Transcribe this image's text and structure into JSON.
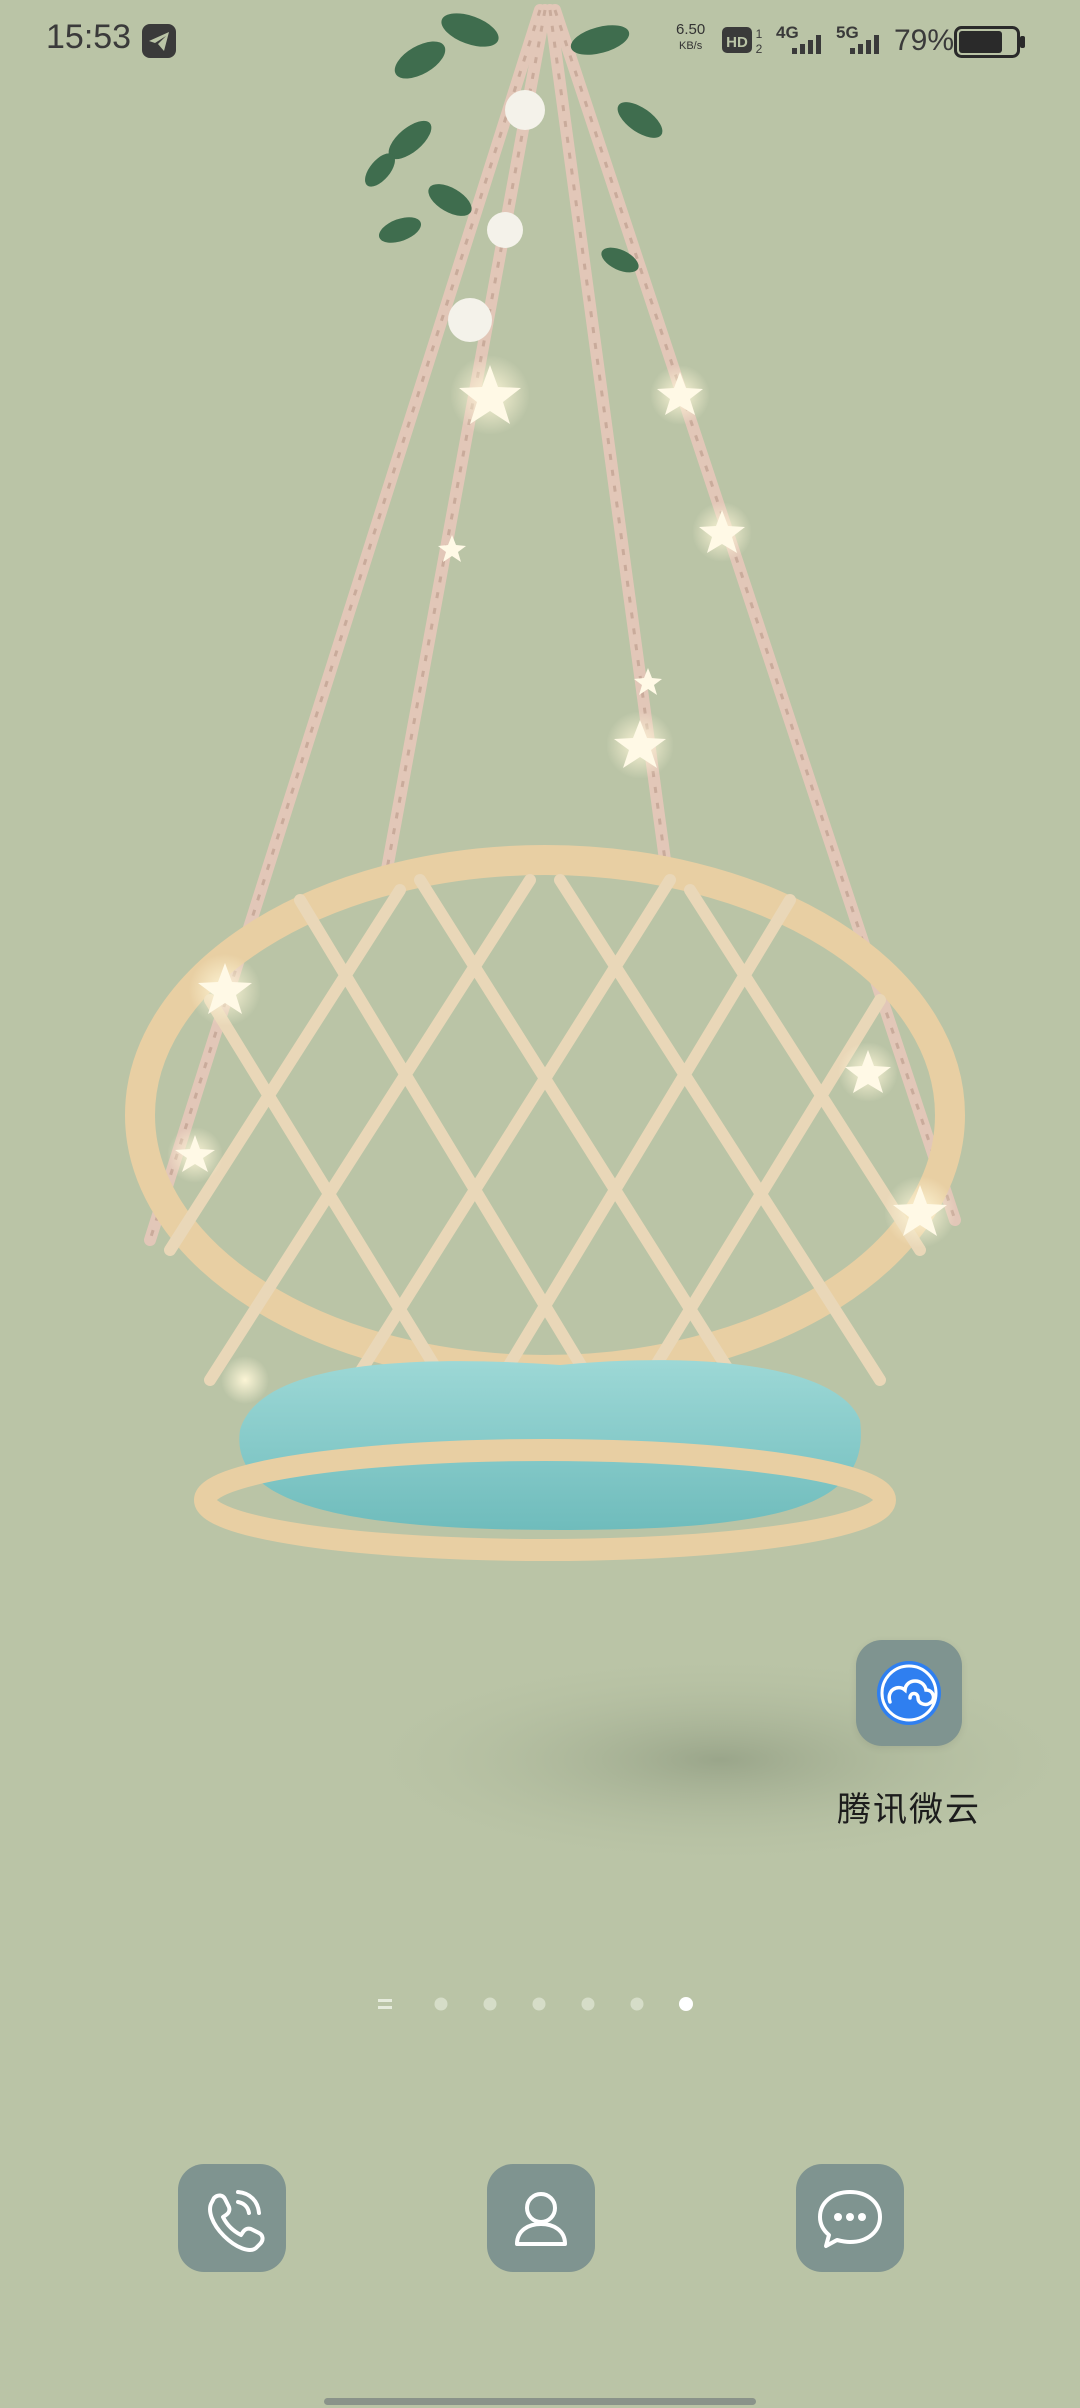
{
  "status_bar": {
    "time": "15:53",
    "net_speed_value": "6.50",
    "net_speed_unit": "KB/s",
    "hd_label": "HD",
    "sim_label_a": "4G",
    "sim_label_b": "5G",
    "battery_percent": "79%",
    "battery_level": 0.79
  },
  "home": {
    "apps": [
      {
        "label": "腾讯微云",
        "icon": "tencent-weiyun-cloud-icon"
      }
    ],
    "page_indicator": {
      "pages": 6,
      "active_index": 5
    }
  },
  "dock": {
    "items": [
      {
        "icon": "phone-icon"
      },
      {
        "icon": "contacts-icon"
      },
      {
        "icon": "messages-icon"
      }
    ]
  },
  "colors": {
    "wallpaper_bg": "#bac4a6",
    "icon_tile": "#7f9490",
    "cushion": "#8fcfcf",
    "rattan": "#e7cfa4"
  }
}
